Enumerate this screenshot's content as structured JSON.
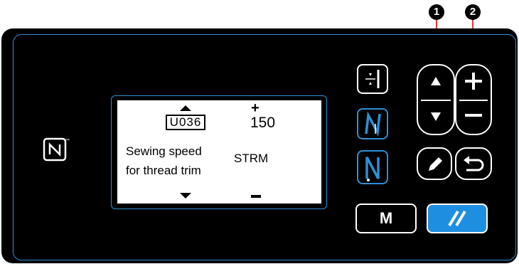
{
  "callouts": {
    "one": "1",
    "two": "2"
  },
  "display": {
    "code": "U036",
    "value": "150",
    "name_line1": "Sewing speed",
    "name_line2": "for thread trim",
    "abbr": "STRM"
  },
  "buttons": {
    "mode_label": "M"
  },
  "colors": {
    "accent": "#2f8fd3",
    "reset_button": "#1e8ee0",
    "callout": "#d63a3a"
  },
  "icons": [
    "nfc-icon",
    "needle-position-icon",
    "up-arrow-icon",
    "down-arrow-icon",
    "plus-icon",
    "minus-icon",
    "thread-trim-icon",
    "bottom-stitch-icon",
    "pencil-icon",
    "return-icon",
    "reset-icon"
  ]
}
